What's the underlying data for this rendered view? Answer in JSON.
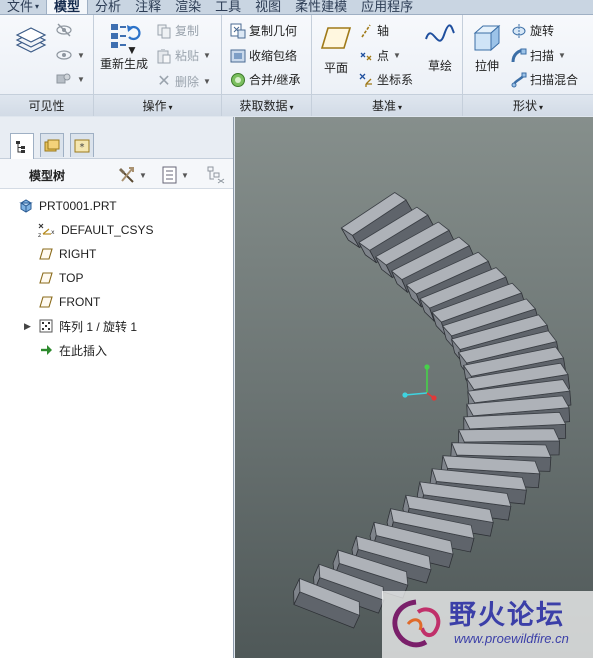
{
  "menu_tabs": [
    {
      "label": "文件",
      "caret": "▾"
    },
    {
      "label": "模型"
    },
    {
      "label": "分析"
    },
    {
      "label": "注释"
    },
    {
      "label": "渲染"
    },
    {
      "label": "工具"
    },
    {
      "label": "视图"
    },
    {
      "label": "柔性建模"
    },
    {
      "label": "应用程序"
    }
  ],
  "ribbon": {
    "groups": {
      "visibility": "可见性",
      "operations": "操作",
      "get_data": "获取数据",
      "datum": "基准",
      "shapes": "形状"
    },
    "commands": {
      "regenerate": "重新生成",
      "copy": "复制",
      "paste": "粘贴",
      "delete": "删除",
      "copy_geometry": "复制几何",
      "shrinkwrap": "收缩包络",
      "merge_inherit": "合并/继承",
      "plane": "平面",
      "axis": "轴",
      "point": "点",
      "csys": "坐标系",
      "sketch": "草绘",
      "extrude": "拉伸",
      "revolve": "旋转",
      "sweep": "扫描",
      "swept_blend": "扫描混合"
    }
  },
  "panel": {
    "title": "模型树"
  },
  "tree": [
    {
      "label": "PRT0001.PRT",
      "icon": "part-icon"
    },
    {
      "label": "DEFAULT_CSYS",
      "icon": "csys-icon"
    },
    {
      "label": "RIGHT",
      "icon": "datum-plane-icon"
    },
    {
      "label": "TOP",
      "icon": "datum-plane-icon"
    },
    {
      "label": "FRONT",
      "icon": "datum-plane-icon"
    },
    {
      "label": "阵列 1 / 旋转 1",
      "icon": "pattern-icon",
      "expandable": true
    },
    {
      "label": "在此插入",
      "icon": "insert-here-arrow-icon"
    }
  ],
  "watermark": {
    "title": "野火论坛",
    "url": "www.proewildfire.cn"
  }
}
